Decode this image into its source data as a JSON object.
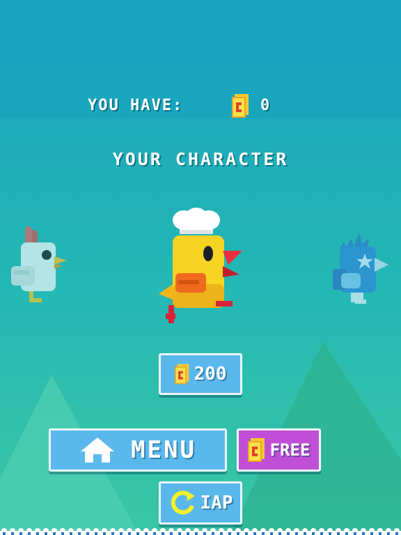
{
  "hud": {
    "label": "YOU HAVE:",
    "coins": "0"
  },
  "screen_title": "YOUR CHARACTER",
  "characters": {
    "left": "white-chicken",
    "center": "yellow-chef-chick",
    "right": "blue-star-bird"
  },
  "buttons": {
    "buy_price": "200",
    "menu_label": "MENU",
    "free_label": "FREE",
    "iap_label": "IAP"
  },
  "colors": {
    "sky_top": "#19a8be",
    "sky_bottom": "#36c4a8",
    "button_blue": "#5ab8ec",
    "button_purple": "#c04ed6",
    "coin": "#f5c932"
  },
  "icons": [
    "coin-icon",
    "home-icon",
    "refresh-icon"
  ]
}
